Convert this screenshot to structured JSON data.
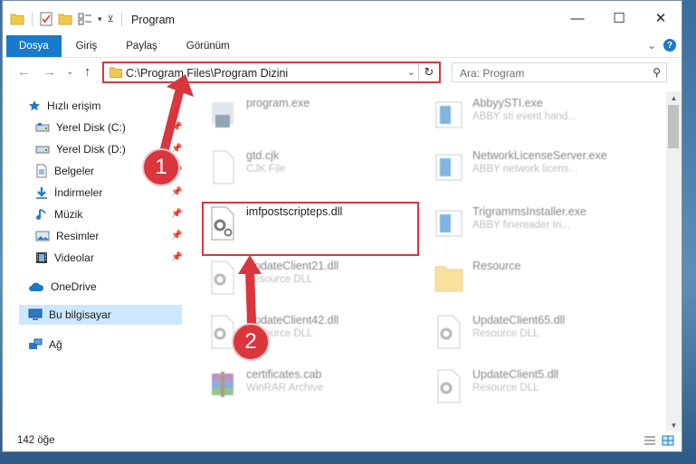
{
  "window": {
    "title": "Program",
    "controls": {
      "minimize": "—",
      "maximize": "☐",
      "close": "✕"
    }
  },
  "ribbon": {
    "tabs": [
      {
        "label": "Dosya",
        "active": true
      },
      {
        "label": "Giriş"
      },
      {
        "label": "Paylaş"
      },
      {
        "label": "Görünüm"
      }
    ],
    "expand_glyph": "⌄",
    "help_glyph": "?"
  },
  "navbar": {
    "back": "←",
    "forward": "→",
    "recent": "⌄",
    "up": "↑",
    "address_path": "C:\\Program Files\\Program Dizini",
    "address_dropdown": "⌄",
    "refresh_glyph": "↻",
    "search_placeholder": "Ara: Program",
    "search_icon": "⚲"
  },
  "sidebar": {
    "items": [
      {
        "label": "Hızlı erişim",
        "icon": "star-icon"
      },
      {
        "label": "Yerel Disk (C:)",
        "icon": "drive-icon",
        "pinned": true
      },
      {
        "label": "Yerel Disk (D:)",
        "icon": "drive-icon",
        "pinned": true
      },
      {
        "label": "Belgeler",
        "icon": "document-icon",
        "pinned": true
      },
      {
        "label": "İndirmeler",
        "icon": "download-icon",
        "pinned": true
      },
      {
        "label": "Müzik",
        "icon": "music-icon",
        "pinned": true
      },
      {
        "label": "Resimler",
        "icon": "pictures-icon",
        "pinned": true
      },
      {
        "label": "Videolar",
        "icon": "video-icon",
        "pinned": true
      },
      {
        "label": "OneDrive",
        "icon": "cloud-icon"
      },
      {
        "label": "Bu bilgisayar",
        "icon": "computer-icon",
        "selected": true
      },
      {
        "label": "Ağ",
        "icon": "network-icon"
      }
    ],
    "pin_glyph": "📌"
  },
  "files": [
    {
      "name": "program.exe",
      "desc": "",
      "icon": "exe-icon"
    },
    {
      "name": "AbbyySTI.exe",
      "desc": "ABBY sti event hand...",
      "icon": "app-icon"
    },
    {
      "name": "gtd.cjk",
      "desc": "CJK File",
      "icon": "file-icon"
    },
    {
      "name": "NetworkLicenseServer.exe",
      "desc": "ABBY network licens...",
      "icon": "app-icon"
    },
    {
      "name": "imfpostscripteps.dll",
      "desc": "",
      "icon": "dll-icon"
    },
    {
      "name": "TrigrammsInstaller.exe",
      "desc": "ABBY finereader tri...",
      "icon": "app-icon"
    },
    {
      "name": "UpdateClient21.dll",
      "desc": "Resource DLL",
      "icon": "dll-icon"
    },
    {
      "name": "Resource",
      "desc": "",
      "icon": "folder-icon"
    },
    {
      "name": "UpdateClient42.dll",
      "desc": "Resource DLL",
      "icon": "dll-icon"
    },
    {
      "name": "UpdateClient65.dll",
      "desc": "Resource DLL",
      "icon": "dll-icon"
    },
    {
      "name": "certificates.cab",
      "desc": "WinRAR Archive",
      "icon": "archive-icon"
    },
    {
      "name": "UpdateClient5.dll",
      "desc": "Resource DLL",
      "icon": "dll-icon"
    }
  ],
  "annotations": {
    "step1": "1",
    "step2": "2"
  },
  "status": {
    "item_count": "142 öğe"
  },
  "colors": {
    "accent": "#1979ca",
    "highlight": "#d9363e",
    "selection": "#cce8ff"
  }
}
